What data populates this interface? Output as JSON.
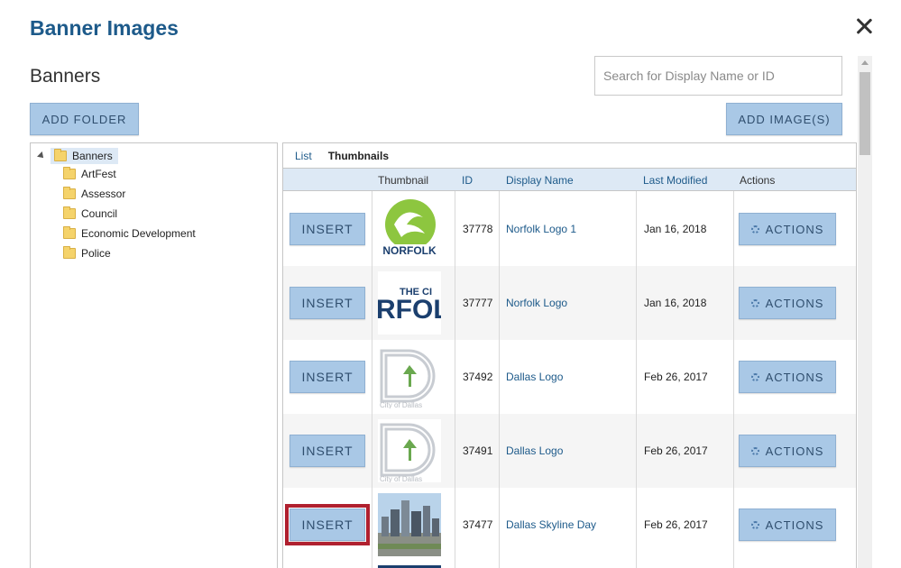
{
  "dialog": {
    "title": "Banner Images"
  },
  "section": {
    "title": "Banners"
  },
  "search": {
    "placeholder": "Search for Display Name or ID"
  },
  "toolbar": {
    "add_folder_label": "ADD FOLDER",
    "add_image_label": "ADD IMAGE(S)"
  },
  "tree": {
    "root": "Banners",
    "items": [
      "ArtFest",
      "Assessor",
      "Council",
      "Economic Development",
      "Police"
    ]
  },
  "view_tabs": {
    "list": "List",
    "thumbnails": "Thumbnails"
  },
  "table": {
    "headers": {
      "thumbnail": "Thumbnail",
      "id": "ID",
      "display_name": "Display Name",
      "last_modified": "Last Modified",
      "actions": "Actions"
    },
    "insert_label": "INSERT",
    "actions_label": "ACTIONS",
    "rows": [
      {
        "id": "37778",
        "name": "Norfolk Logo 1",
        "date": "Jan 16, 2018",
        "thumb_text": "NORFOLK"
      },
      {
        "id": "37777",
        "name": "Norfolk Logo",
        "date": "Jan 16, 2018",
        "thumb_text": "RFOL",
        "thumb_top": "THE CI"
      },
      {
        "id": "37492",
        "name": "Dallas Logo",
        "date": "Feb 26, 2017",
        "thumb_text": "City of Dallas"
      },
      {
        "id": "37491",
        "name": "Dallas Logo",
        "date": "Feb 26, 2017",
        "thumb_text": "City of Dallas"
      },
      {
        "id": "37477",
        "name": "Dallas Skyline Day",
        "date": "Feb 26, 2017"
      }
    ]
  },
  "colors": {
    "accent": "#1d5a8a",
    "button": "#a9c8e6",
    "highlight": "#b0202f"
  }
}
